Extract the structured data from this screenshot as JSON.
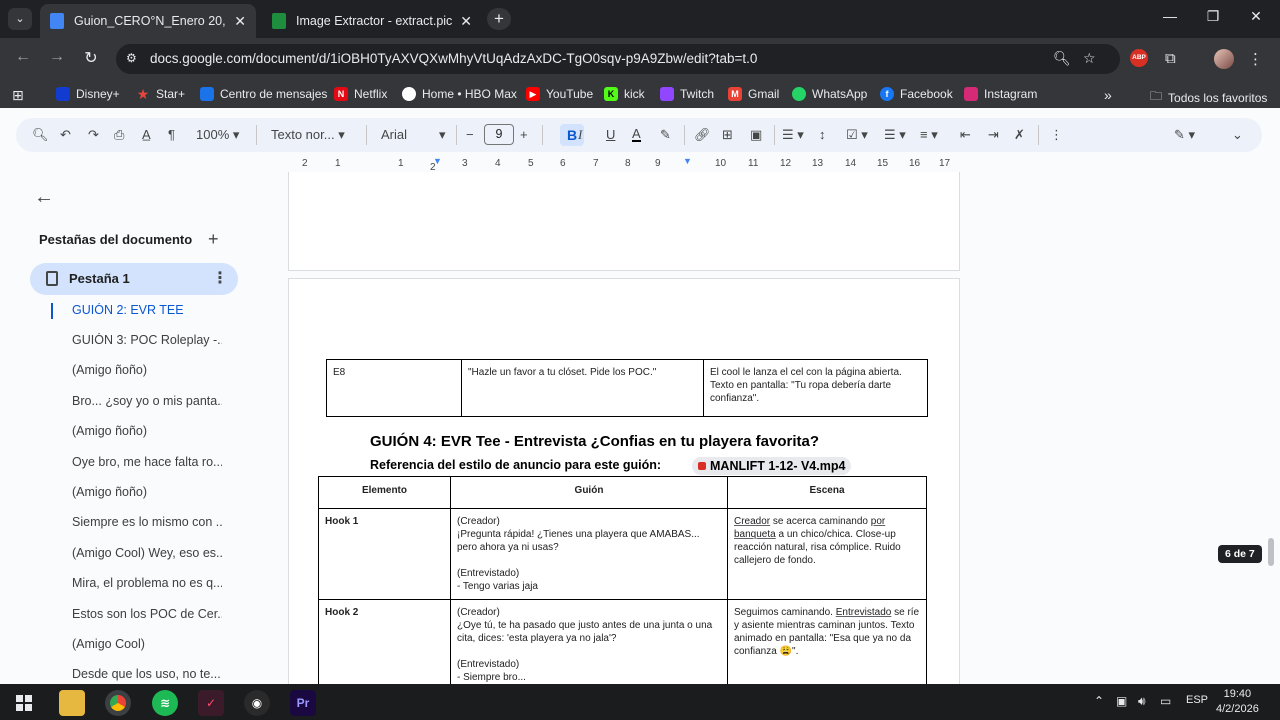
{
  "browser": {
    "tabs": [
      {
        "title": "Guion_CERO°N_Enero 20, 2026",
        "active": true,
        "favicon_color": "#4285f4"
      },
      {
        "title": "Image Extractor - extract.pics",
        "active": false,
        "favicon_color": "#1e8e3e"
      }
    ],
    "new_tab": "+",
    "url": "docs.google.com/document/d/1iOBH0TyAXVQXwMhyVtUqAdzAxDC-TgO0sqv-p9A9Zbw/edit?tab=t.0",
    "bookmarks": [
      {
        "label": "Disney+",
        "icon_color": "#113ccf"
      },
      {
        "label": "Star+",
        "icon_color": "#e8453c"
      },
      {
        "label": "Centro de mensajes",
        "icon_color": "#1a73e8"
      },
      {
        "label": "Netflix",
        "icon_color": "#e50914"
      },
      {
        "label": "Home • HBO Max",
        "icon_color": "#ffffff"
      },
      {
        "label": "YouTube",
        "icon_color": "#ff0000"
      },
      {
        "label": "kick",
        "icon_color": "#53fc18"
      },
      {
        "label": "Twitch",
        "icon_color": "#9146ff"
      },
      {
        "label": "Gmail",
        "icon_color": "#ea4335"
      },
      {
        "label": "WhatsApp",
        "icon_color": "#25d366"
      },
      {
        "label": "Facebook",
        "icon_color": "#1877f2"
      },
      {
        "label": "Instagram",
        "icon_color": "#d62976"
      }
    ],
    "all_bookmarks": "Todos los favoritos"
  },
  "toolbar": {
    "zoom": "100%",
    "style": "Texto nor...",
    "font": "Arial",
    "font_size": "9"
  },
  "ruler": [
    "2",
    "1",
    "1",
    "2",
    "3",
    "4",
    "5",
    "6",
    "7",
    "8",
    "9",
    "10",
    "11",
    "12",
    "13",
    "14",
    "15",
    "16",
    "17",
    "18"
  ],
  "sidebar": {
    "title": "Pestañas del documento",
    "tab_label": "Pestaña 1",
    "outline": [
      "GUIÓN 2: EVR TEE",
      "GUIÓN 3: POC Roleplay -...",
      "(Amigo ñoño)",
      "Bro... ¿soy yo o mis panta...",
      "(Amigo ñoño)",
      "Oye bro, me hace falta ro...",
      "(Amigo ñoño)",
      "Siempre es lo mismo con ...",
      "(Amigo Cool) Wey, eso es...",
      "Mira, el problema no es q...",
      "Estos son los POC de Cer...",
      "(Amigo Cool)",
      "Desde que los uso, no te..."
    ]
  },
  "doc": {
    "table1": {
      "id": "E8",
      "guion": "\"Hazle un favor a tu clóset. Pide los POC.\"",
      "escena": "El cool le lanza el cel con la página abierta. Texto en pantalla: \"Tu ropa debería darte confianza\"."
    },
    "heading": "GUIÓN 4: EVR Tee - Entrevista ¿Confias en tu playera favorita?",
    "reference_label": "Referencia del estilo de anuncio para este guión:",
    "reference_chip": "MANLIFT 1-12- V4.mp4",
    "table2": {
      "headers": [
        "Elemento",
        "Guión",
        "Escena"
      ],
      "rows": [
        {
          "element": "Hook 1",
          "guion": [
            "(Creador)",
            "¡Pregunta rápida! ¿Tienes una playera que AMABAS... pero ahora ya ni usas?",
            "",
            "(Entrevistado)",
            "- Tengo varias jaja"
          ],
          "escena_a": "Creador",
          "escena_b": " se acerca caminando ",
          "escena_c": "por banqueta",
          "escena_d": " a un chico/chica. Close-up reacción natural, risa cómplice. Ruido callejero de fondo."
        },
        {
          "element": "Hook 2",
          "guion": [
            "(Creador)",
            "¿Oye tú, te ha pasado que justo antes de una junta o una cita, dices: 'esta playera ya no jala'?",
            "",
            "(Entrevistado)",
            "- Siempre bro..."
          ],
          "escena_a": "Seguimos caminando. ",
          "escena_b": "Entrevistado",
          "escena_c": " se ríe y asiente mientras caminan juntos. Texto animado en pantalla: \"Esa que ya no da confianza ",
          "escena_d": "😩\"."
        }
      ]
    }
  },
  "page_indicator": "6 de 7",
  "taskbar": {
    "lang": "ESP",
    "time": "19:40",
    "date": "4/2/2026"
  }
}
